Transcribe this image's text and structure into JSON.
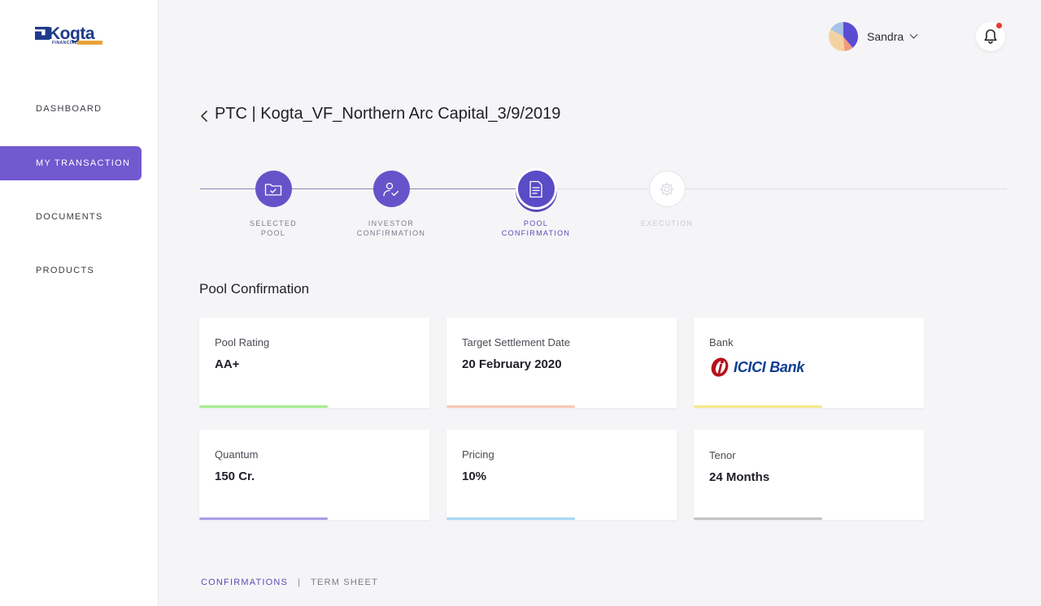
{
  "brand": {
    "name": "Kogta",
    "sub": "FINANCIAL"
  },
  "sidebar": {
    "items": [
      {
        "label": "DASHBOARD",
        "active": false
      },
      {
        "label": "MY TRANSACTION",
        "active": true
      },
      {
        "label": "DOCUMENTS",
        "active": false
      },
      {
        "label": "PRODUCTS",
        "active": false
      }
    ]
  },
  "header": {
    "user_name": "Sandra",
    "notification_badge_color": "#e53935"
  },
  "page": {
    "title": "PTC | Kogta_VF_Northern Arc Capital_3/9/2019"
  },
  "stepper": {
    "steps": [
      {
        "line1": "SELECTED",
        "line2": "POOL",
        "state": "done",
        "icon": "folder-check-icon"
      },
      {
        "line1": "INVESTOR",
        "line2": "CONFIRMATION",
        "state": "done",
        "icon": "user-check-icon"
      },
      {
        "line1": "POOL",
        "line2": "CONFIRMATION",
        "state": "current",
        "icon": "document-list-icon"
      },
      {
        "line1": "EXECUTION",
        "line2": "",
        "state": "pending",
        "icon": "gear-icon"
      }
    ]
  },
  "section": {
    "title": "Pool Confirmation",
    "cards": [
      {
        "label": "Pool Rating",
        "value": "AA+",
        "accent": "#a6ed8e"
      },
      {
        "label": "Target Settlement Date",
        "value": "20 February 2020",
        "accent": "#f9c8b1"
      },
      {
        "label": "Bank",
        "value": "ICICI Bank",
        "accent": "#f5e88a"
      },
      {
        "label": "Quantum",
        "value": "150 Cr.",
        "accent": "#a99ce6"
      },
      {
        "label": "Pricing",
        "value": "10%",
        "accent": "#a6d9f2"
      },
      {
        "label": "Tenor",
        "value": "24 Months",
        "accent": "#c3c3c6"
      }
    ]
  },
  "tabs": {
    "items": [
      {
        "label": "CONFIRMATIONS",
        "active": true
      },
      {
        "label": "TERM SHEET",
        "active": false
      }
    ],
    "separator": "|"
  },
  "colors": {
    "primary": "#7159cf",
    "primary_dark": "#5a4bb8"
  }
}
